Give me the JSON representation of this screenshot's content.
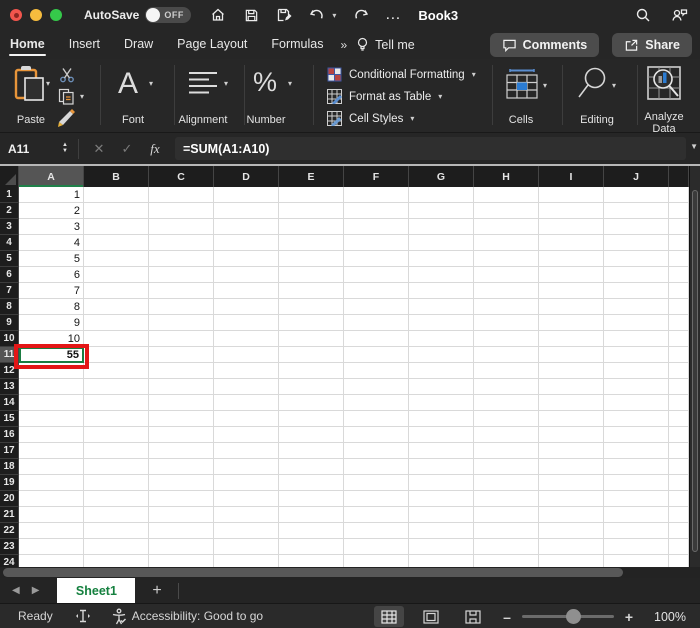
{
  "titlebar": {
    "autosave_label": "AutoSave",
    "autosave_state": "OFF",
    "title": "Book3"
  },
  "tabs": {
    "items": [
      "Home",
      "Insert",
      "Draw",
      "Page Layout",
      "Formulas"
    ],
    "active": "Home",
    "overflow_glyph": "»",
    "tellme_label": "Tell me",
    "comments_label": "Comments",
    "share_label": "Share"
  },
  "ribbon": {
    "paste_label": "Paste",
    "font_label": "Font",
    "alignment_label": "Alignment",
    "number_label": "Number",
    "number_glyph": "%",
    "font_glyph": "A",
    "styles": [
      "Conditional Formatting",
      "Format as Table",
      "Cell Styles"
    ],
    "cells_label": "Cells",
    "editing_label": "Editing",
    "analyze_label_1": "Analyze",
    "analyze_label_2": "Data"
  },
  "formula_bar": {
    "name_box": "A11",
    "formula": "=SUM(A1:A10)",
    "cancel_glyph": "✕",
    "enter_glyph": "✓",
    "fx_glyph": "fx"
  },
  "grid": {
    "columns": [
      "A",
      "B",
      "C",
      "D",
      "E",
      "F",
      "G",
      "H",
      "I",
      "J"
    ],
    "row_count": 24,
    "values": {
      "A1": "1",
      "A2": "2",
      "A3": "3",
      "A4": "4",
      "A5": "5",
      "A6": "6",
      "A7": "7",
      "A8": "8",
      "A9": "9",
      "A10": "10",
      "A11": "55"
    },
    "active_cell": "A11",
    "active_col": "A",
    "active_row": 11
  },
  "sheet_tabs": {
    "active_tab": "Sheet1",
    "add_glyph": "+",
    "prev_glyph": "◀",
    "next_glyph": "▶"
  },
  "status_bar": {
    "ready": "Ready",
    "accessibility": "Accessibility: Good to go",
    "zoom_pct": "100%",
    "minus_glyph": "–",
    "plus_glyph": "+"
  },
  "colors": {
    "excel_green": "#15803f",
    "selection_green": "#1b7c42",
    "annotation_red": "#e31616",
    "accent_blue": "#2b7cd3"
  }
}
